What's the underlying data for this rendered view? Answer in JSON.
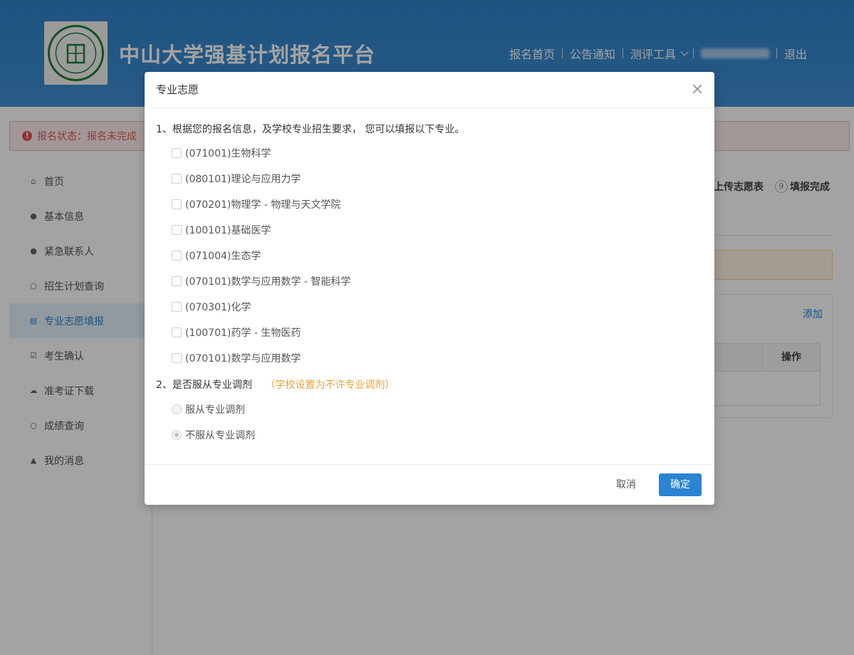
{
  "header": {
    "site_title": "中山大学强基计划报名平台",
    "nav": {
      "home": "报名首页",
      "notice": "公告通知",
      "tools": "测评工具",
      "logout": "退出"
    }
  },
  "status": {
    "text": "报名状态：报名未完成"
  },
  "sidebar": {
    "items": [
      {
        "label": "首页",
        "icon": "home-icon"
      },
      {
        "label": "基本信息",
        "icon": "user-icon"
      },
      {
        "label": "紧急联系人",
        "icon": "user-icon"
      },
      {
        "label": "招生计划查询",
        "icon": "search-icon"
      },
      {
        "label": "专业志愿填报",
        "icon": "document-icon",
        "active": true
      },
      {
        "label": "考生确认",
        "icon": "check-icon"
      },
      {
        "label": "准考证下载",
        "icon": "cloud-download-icon"
      },
      {
        "label": "成绩查询",
        "icon": "search-icon"
      },
      {
        "label": "我的消息",
        "icon": "bell-icon"
      }
    ]
  },
  "main": {
    "steps": {
      "upload_label": "上传志愿表",
      "step9_num": "9",
      "finish_label": "填报完成"
    },
    "panel": {
      "add_label": "添加",
      "col_op": "操作"
    }
  },
  "modal": {
    "title": "专业志愿",
    "q1": "1、根据您的报名信息，及学校专业招生要求， 您可以填报以下专业。",
    "majors": [
      "(071001)生物科学",
      "(080101)理论与应用力学",
      "(070201)物理学 - 物理与天文学院",
      "(100101)基础医学",
      "(071004)生态学",
      "(070101)数学与应用数学 - 智能科学",
      "(070301)化学",
      "(100701)药学 - 生物医药",
      "(070101)数学与应用数学"
    ],
    "q2": "2、是否服从专业调剂",
    "q2_hint": "（学校设置为不许专业调剂）",
    "adjust_options": [
      {
        "label": "服从专业调剂",
        "checked": false
      },
      {
        "label": "不服从专业调剂",
        "checked": true
      }
    ],
    "cancel_label": "取消",
    "ok_label": "确定"
  },
  "colors": {
    "header_blue": "#3587cc",
    "accent_blue": "#2a84d2",
    "hint_orange": "#e6a23c",
    "status_red": "#e05a5a"
  }
}
